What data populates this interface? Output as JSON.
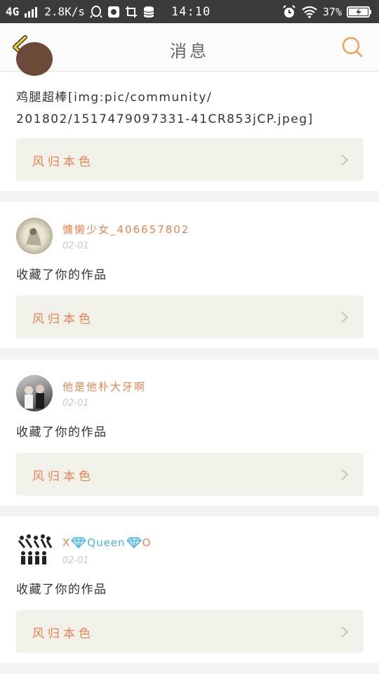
{
  "status_bar": {
    "network": "4G",
    "speed": "2.8K/s",
    "time": "14:10",
    "battery": "37%",
    "icons": [
      "signal-icon",
      "qq-icon",
      "app-icon",
      "screenshot-icon",
      "storage-icon",
      "alarm-icon",
      "wifi-icon",
      "battery-icon"
    ]
  },
  "nav": {
    "title": "消息",
    "back_icon": "chevron-left-icon",
    "search_icon": "search-icon",
    "accent": "#f0a451"
  },
  "colors": {
    "accent": "#e8844f",
    "link_bg": "#f1f1ea",
    "time": "#c8c8c8",
    "divider": "#f3f3f3"
  },
  "messages": [
    {
      "message": "鸡腿超棒[img:pic/community/\n201802/1517479097331-41CR853jCP.jpeg]",
      "work_title": "风归本色"
    },
    {
      "username": "慵懒少女_406657802",
      "time": "02-01",
      "message": "收藏了你的作品",
      "work_title": "风归本色"
    },
    {
      "username": "他是他朴大牙啊",
      "time": "02-01",
      "message": "收藏了你的作品",
      "work_title": "风归本色"
    },
    {
      "username_prefix": "X",
      "username_middle": "Queen",
      "username_suffix": "O",
      "time": "02-01",
      "message": "收藏了你的作品",
      "work_title": "风归本色"
    }
  ]
}
